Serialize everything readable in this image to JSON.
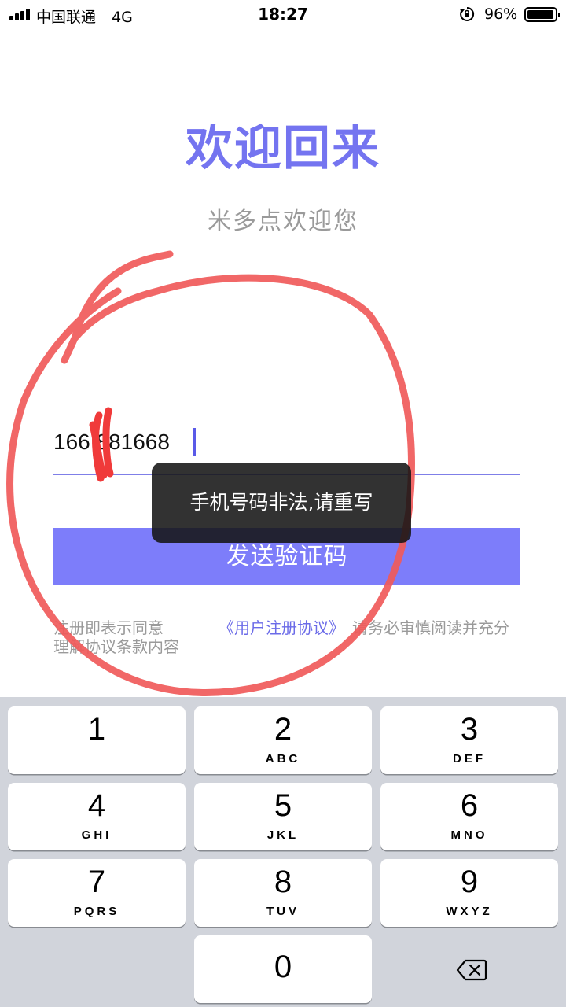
{
  "status_bar": {
    "carrier": "中国联通",
    "network": "4G",
    "time": "18:27",
    "battery": "96%"
  },
  "main": {
    "title": "欢迎回来",
    "subtitle": "米多点欢迎您",
    "phone_value": "166  881668",
    "send_button": "发送验证码",
    "toast": "手机号码非法,请重写",
    "agreement_prefix": "注册即表示同意",
    "agreement_link": "《用户注册协议》",
    "agreement_suffix": "请务必审慎阅读并充分",
    "agreement_line2": "理解协议条款内容"
  },
  "colors": {
    "accent": "#7474F0",
    "button": "#7d7dfa",
    "annotation": "#f05a5a"
  },
  "keypad": {
    "keys": [
      {
        "digit": "1",
        "letters": ""
      },
      {
        "digit": "2",
        "letters": "ABC"
      },
      {
        "digit": "3",
        "letters": "DEF"
      },
      {
        "digit": "4",
        "letters": "GHI"
      },
      {
        "digit": "5",
        "letters": "JKL"
      },
      {
        "digit": "6",
        "letters": "MNO"
      },
      {
        "digit": "7",
        "letters": "PQRS"
      },
      {
        "digit": "8",
        "letters": "TUV"
      },
      {
        "digit": "9",
        "letters": "WXYZ"
      },
      {
        "digit": "0",
        "letters": ""
      }
    ],
    "delete_icon": "backspace-icon"
  }
}
